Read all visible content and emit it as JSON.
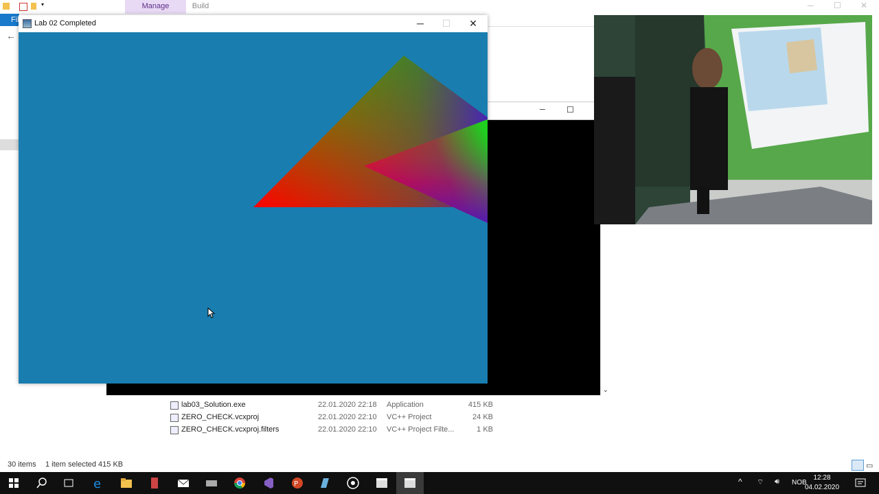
{
  "explorer": {
    "ribbon_tabs": [
      "Manage",
      "Build"
    ],
    "file_tab": "Fil",
    "files": [
      {
        "name": "lab03_Solution.exe",
        "date": "22.01.2020 22:18",
        "type": "Application",
        "size": "415 KB"
      },
      {
        "name": "ZERO_CHECK.vcxproj",
        "date": "22.01.2020 22:10",
        "type": "VC++ Project",
        "size": "24 KB"
      },
      {
        "name": "ZERO_CHECK.vcxproj.filters",
        "date": "22.01.2020 22:10",
        "type": "VC++ Project Filte...",
        "size": "1 KB"
      }
    ],
    "status_items": "30 items",
    "status_selected": "1 item selected  415 KB"
  },
  "main_window": {
    "title": "Lab 02 Completed",
    "minimize": "─",
    "maximize": "☐",
    "close": "✕",
    "background_color": "#1a7db0"
  },
  "console_window": {
    "minimize": "─",
    "maximize": "☐"
  },
  "taskbar": {
    "language": "NOB",
    "time": "12:28",
    "date": "04.02.2020",
    "icons": [
      "windows-start-icon",
      "search-icon",
      "task-view-icon",
      "edge-icon",
      "file-explorer-icon",
      "tool-icon",
      "mail-icon",
      "storage-icon",
      "chrome-icon",
      "visual-studio-icon",
      "powerpoint-icon",
      "notepad-icon",
      "obs-icon",
      "app-window-icon",
      "app-window-icon-active"
    ]
  }
}
